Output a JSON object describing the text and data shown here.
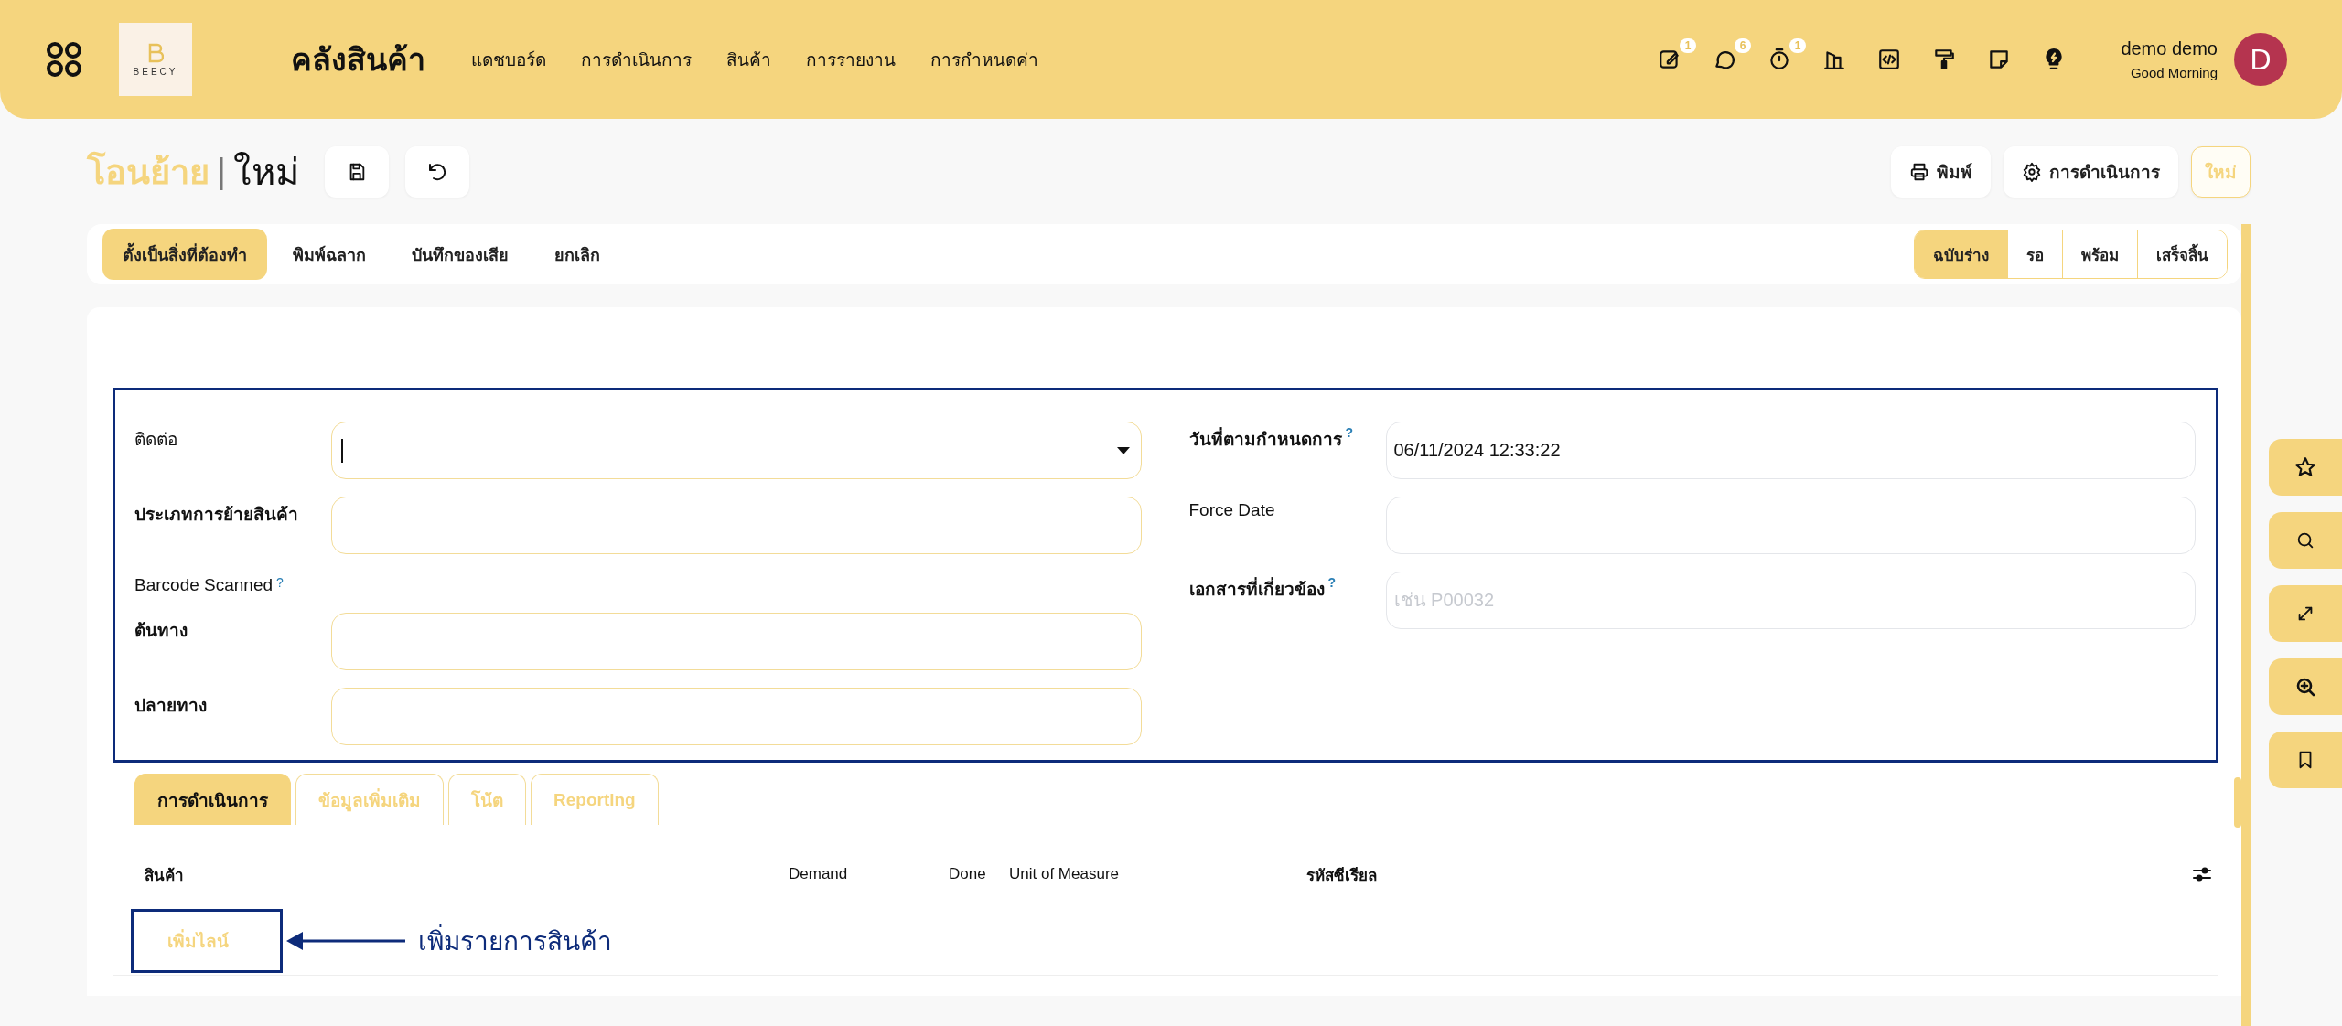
{
  "navbar": {
    "title": "คลังสินค้า",
    "logo_text": "BEECY",
    "menu": [
      "แดชบอร์ด",
      "การดำเนินการ",
      "สินค้า",
      "การรายงาน",
      "การกำหนดค่า"
    ],
    "systray": [
      {
        "kind": "edit",
        "badge": "1"
      },
      {
        "kind": "chat",
        "badge": "6"
      },
      {
        "kind": "timer",
        "badge": "1"
      },
      {
        "kind": "building"
      },
      {
        "kind": "code"
      },
      {
        "kind": "paint"
      },
      {
        "kind": "note"
      },
      {
        "kind": "bulb"
      }
    ],
    "user": {
      "name": "demo demo",
      "greeting": "Good Morning",
      "initial": "D"
    }
  },
  "breadcrumb": {
    "parent": "โอนย้าย",
    "separator": "|",
    "current": "ใหม่"
  },
  "control_buttons": [
    {
      "kind": "print",
      "label": "พิมพ์"
    },
    {
      "kind": "gear",
      "label": "การดำเนินการ"
    },
    {
      "kind": "new",
      "label": "ใหม่"
    }
  ],
  "header_buttons": [
    {
      "label": "ตั้งเป็นสิ่งที่ต้องทำ",
      "primary": true
    },
    {
      "label": "พิมพ์ฉลาก",
      "primary": false
    },
    {
      "label": "บันทึกของเสีย",
      "primary": false
    },
    {
      "label": "ยกเลิก",
      "primary": false
    }
  ],
  "statuses": [
    {
      "label": "ฉบับร่าง",
      "selected": true
    },
    {
      "label": "รอ",
      "selected": false
    },
    {
      "label": "พร้อม",
      "selected": false
    },
    {
      "label": "เสร็จสิ้น",
      "selected": false
    }
  ],
  "form": {
    "left": [
      {
        "label": "ติดต่อ",
        "required": false,
        "kind": "select",
        "focused": true
      },
      {
        "label": "ประเภทการย้ายสินค้า",
        "required": true,
        "kind": "text"
      },
      {
        "label": "Barcode Scanned",
        "help": "?",
        "required": false,
        "kind": "none"
      },
      {
        "label": "ต้นทาง",
        "required": true,
        "kind": "text"
      },
      {
        "label": "ปลายทาง",
        "required": true,
        "kind": "text"
      }
    ],
    "right": [
      {
        "label": "วันที่ตามกำหนดการ",
        "help": "?",
        "required": true,
        "kind": "text",
        "value": "06/11/2024 12:33:22"
      },
      {
        "label": "Force Date",
        "required": false,
        "kind": "text"
      },
      {
        "label": "เอกสารที่เกี่ยวข้อง",
        "help": "?",
        "required": true,
        "kind": "text",
        "placeholder": "เช่น P00032"
      }
    ]
  },
  "tabs": [
    {
      "label": "การดำเนินการ",
      "selected": true
    },
    {
      "label": "ข้อมูลเพิ่มเติม",
      "selected": false
    },
    {
      "label": "โน้ต",
      "selected": false
    },
    {
      "label": "Reporting",
      "selected": false
    }
  ],
  "table": {
    "columns": [
      "สินค้า",
      "Demand",
      "Done",
      "Unit of Measure",
      "รหัสซีเรียล"
    ],
    "add_line": "เพิ่มไลน์"
  },
  "annotation": {
    "text": "เพิ่มรายการสินค้า"
  },
  "side_tools": [
    {
      "kind": "star"
    },
    {
      "kind": "search"
    },
    {
      "kind": "expand"
    },
    {
      "kind": "zoom"
    },
    {
      "kind": "bookmark"
    }
  ]
}
